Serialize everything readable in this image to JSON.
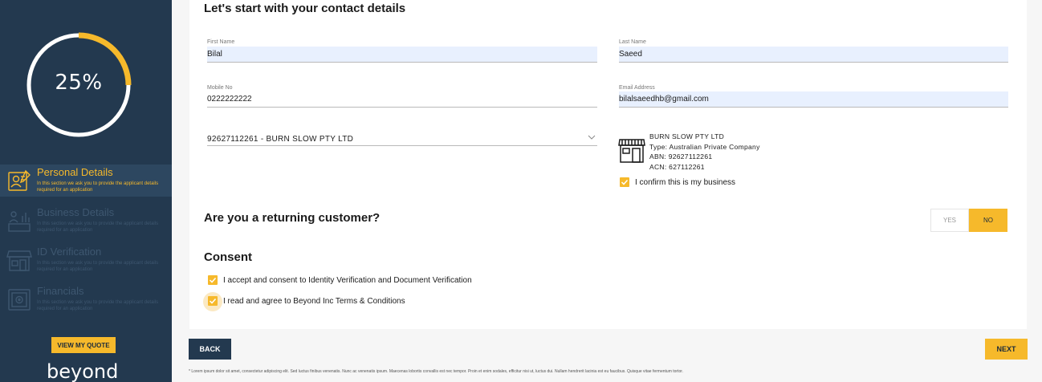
{
  "sidebar": {
    "progress_text": "25%",
    "progress_fraction": 0.25,
    "steps": [
      {
        "title": "Personal Details",
        "desc": "In this section we ask you to provide the applicant details required for an application",
        "icon": "user-id-card-icon",
        "state": "active"
      },
      {
        "title": "Business Details",
        "desc": "In this section we ask you to provide the applicant details required for an application",
        "icon": "business-chart-icon",
        "state": "inactive"
      },
      {
        "title": "ID Verification",
        "desc": "In this section we ask you to provide the applicant details required for an application",
        "icon": "storefront-icon",
        "state": "inactive"
      },
      {
        "title": "Financials",
        "desc": "In this section we ask you to provide the applicant details required for an application",
        "icon": "safe-icon",
        "state": "inactive"
      }
    ],
    "quote_button": "VIEW MY QUOTE",
    "logo": "beyond"
  },
  "contact": {
    "heading": "Let's start with your contact details",
    "first_name_label": "First Name",
    "first_name_value": "Bilal",
    "last_name_label": "Last Name",
    "last_name_value": "Saeed",
    "mobile_label": "Mobile No",
    "mobile_value": "0222222222",
    "email_label": "Email Address",
    "email_value": "bilalsaeedhb@gmail.com",
    "business_select_value": "92627112261 - BURN SLOW PTY LTD"
  },
  "business": {
    "name": "BURN SLOW PTY LTD",
    "type": "Type: Australian Private Company",
    "abn": "ABN: 92627112261",
    "acn": "ACN: 627112261",
    "confirm_label": "I confirm this is my business",
    "confirm_checked": true
  },
  "returning": {
    "heading": "Are you a returning customer?",
    "yes": "YES",
    "no": "NO",
    "selected": "NO"
  },
  "consent": {
    "heading": "Consent",
    "item1": "I accept and consent to Identity Verification and Document Verification",
    "item2": "I read and agree to Beyond Inc Terms & Conditions"
  },
  "nav": {
    "back": "BACK",
    "next": "NEXT"
  },
  "footer": "* Lorem ipsum dolor sit amet, consectetur adipiscing elit. Sed luctus finibus venenatis. Nunc ac venenatis ipsum. Maecenas lobortis convallis est nec tempor. Proin et enim sodales, efficitur nisi ut, luctus dui. Nullam hendrerit lacinia est eu faucibus. Quisque vitae fermentum tortor.",
  "colors": {
    "sidebar": "#23394f",
    "accent": "#f6b92b",
    "autofill": "#e8f0fe"
  }
}
